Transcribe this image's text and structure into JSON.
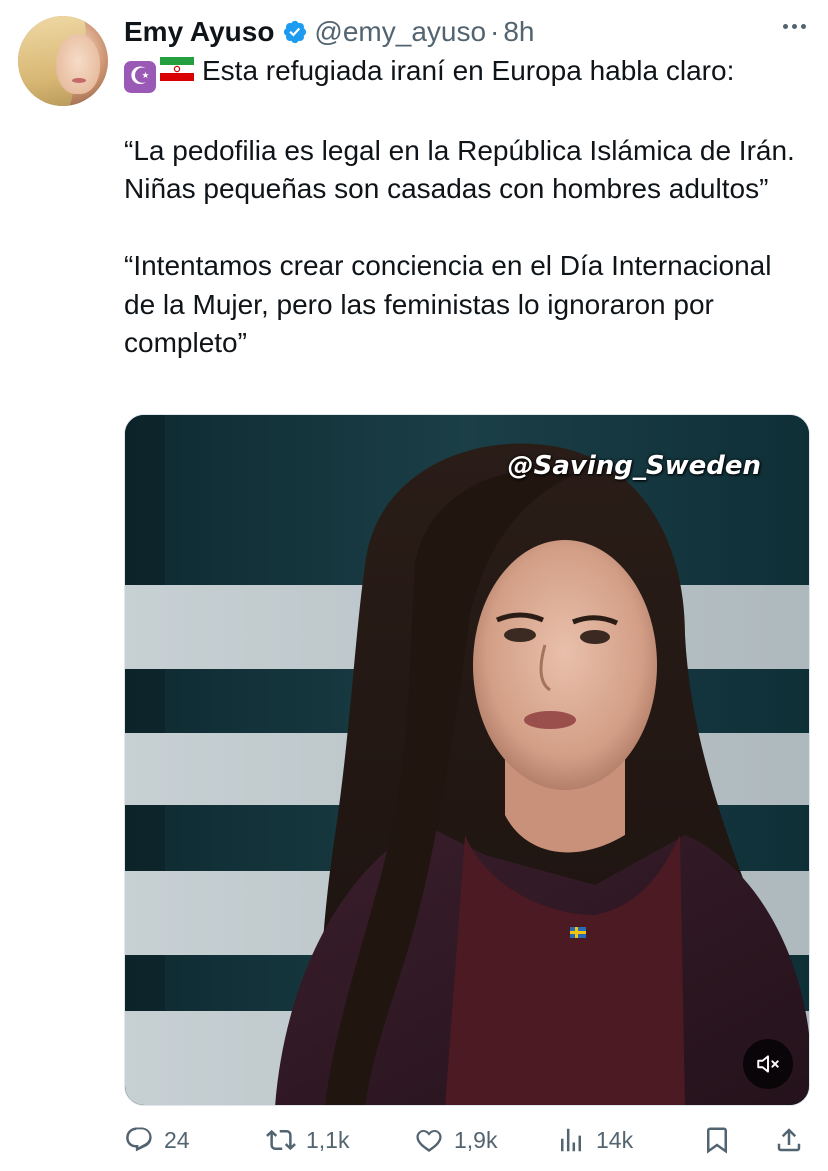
{
  "author": {
    "name": "Emy Ayuso",
    "handle": "@emy_ayuso",
    "separator": "·",
    "time": "8h",
    "verified": true
  },
  "tweet": {
    "first_line": "Esta refugiada iraní en Europa habla claro:",
    "first_line_emojis": [
      "star-and-crescent-emoji",
      "iran-flag-emoji"
    ],
    "quote1": "“La pedofilia es legal en la República Islámica de Irán. Niñas pequeñas son casadas con hombres adultos”",
    "quote2": "“Intentamos crear conciencia en el Día Internacional de la Mujer, pero las feministas lo ignoraron por completo”"
  },
  "media": {
    "watermark": "@Saving_Sweden",
    "type": "video",
    "muted": true
  },
  "actions": {
    "replies": "24",
    "retweets": "1,1k",
    "likes": "1,9k",
    "views": "14k"
  },
  "colors": {
    "text": "#0f1419",
    "secondary": "#536471",
    "verified_badge": "#1d9bf0"
  }
}
